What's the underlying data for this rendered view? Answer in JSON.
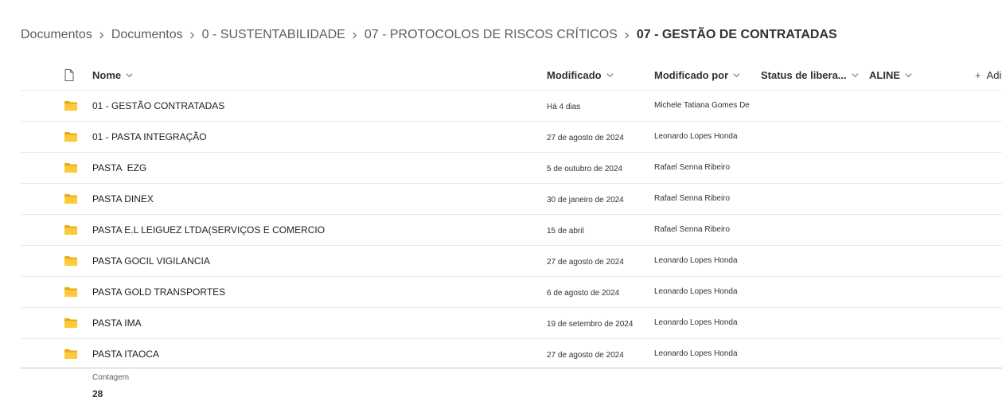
{
  "breadcrumb": [
    {
      "label": "Documentos",
      "current": false
    },
    {
      "label": "Documentos",
      "current": false
    },
    {
      "label": "0 - SUSTENTABILIDADE",
      "current": false
    },
    {
      "label": "07 - PROTOCOLOS DE RISCOS CRÍTICOS",
      "current": false
    },
    {
      "label": "07 - GESTÃO DE CONTRATADAS",
      "current": true
    }
  ],
  "columns": {
    "file_type_icon": "document-icon",
    "name": "Nome",
    "modified": "Modificado",
    "modified_by": "Modificado por",
    "release_status": "Status de libera...",
    "aline": "ALINE",
    "add_column": "Adi"
  },
  "rows": [
    {
      "icon": "folder-icon",
      "name": "01 - GESTÃO CONTRATADAS",
      "modified": "Há 4 dias",
      "modified_by": "Michele Tatiana Gomes De"
    },
    {
      "icon": "folder-icon",
      "name": "01 - PASTA INTEGRAÇÃO",
      "modified": "27 de agosto de 2024",
      "modified_by": "Leonardo Lopes Honda"
    },
    {
      "icon": "folder-icon",
      "name": "PASTA  EZG",
      "modified": "5 de outubro de 2024",
      "modified_by": "Rafael Senna Ribeiro"
    },
    {
      "icon": "folder-icon",
      "name": "PASTA DINEX",
      "modified": "30 de janeiro de 2024",
      "modified_by": "Rafael Senna Ribeiro"
    },
    {
      "icon": "folder-icon",
      "name": "PASTA E.L LEIGUEZ LTDA(SERVIÇOS E COMERCIO",
      "modified": "15 de abril",
      "modified_by": "Rafael Senna Ribeiro"
    },
    {
      "icon": "folder-icon",
      "name": "PASTA GOCIL VIGILANCIA",
      "modified": "27 de agosto de 2024",
      "modified_by": "Leonardo Lopes Honda"
    },
    {
      "icon": "folder-icon",
      "name": "PASTA GOLD TRANSPORTES",
      "modified": "6 de agosto de 2024",
      "modified_by": "Leonardo Lopes Honda"
    },
    {
      "icon": "folder-icon",
      "name": "PASTA IMA",
      "modified": "19 de setembro de 2024",
      "modified_by": "Leonardo Lopes Honda"
    },
    {
      "icon": "folder-icon",
      "name": "PASTA ITAOCA",
      "modified": "27 de agosto de 2024",
      "modified_by": "Leonardo Lopes Honda"
    }
  ],
  "footer": {
    "count_label": "Contagem",
    "count_value": "28"
  },
  "colors": {
    "folder": "#ffc93b",
    "folder_back": "#e8a91a",
    "text": "#323130",
    "muted": "#605e5c",
    "divider": "#edebe9"
  }
}
